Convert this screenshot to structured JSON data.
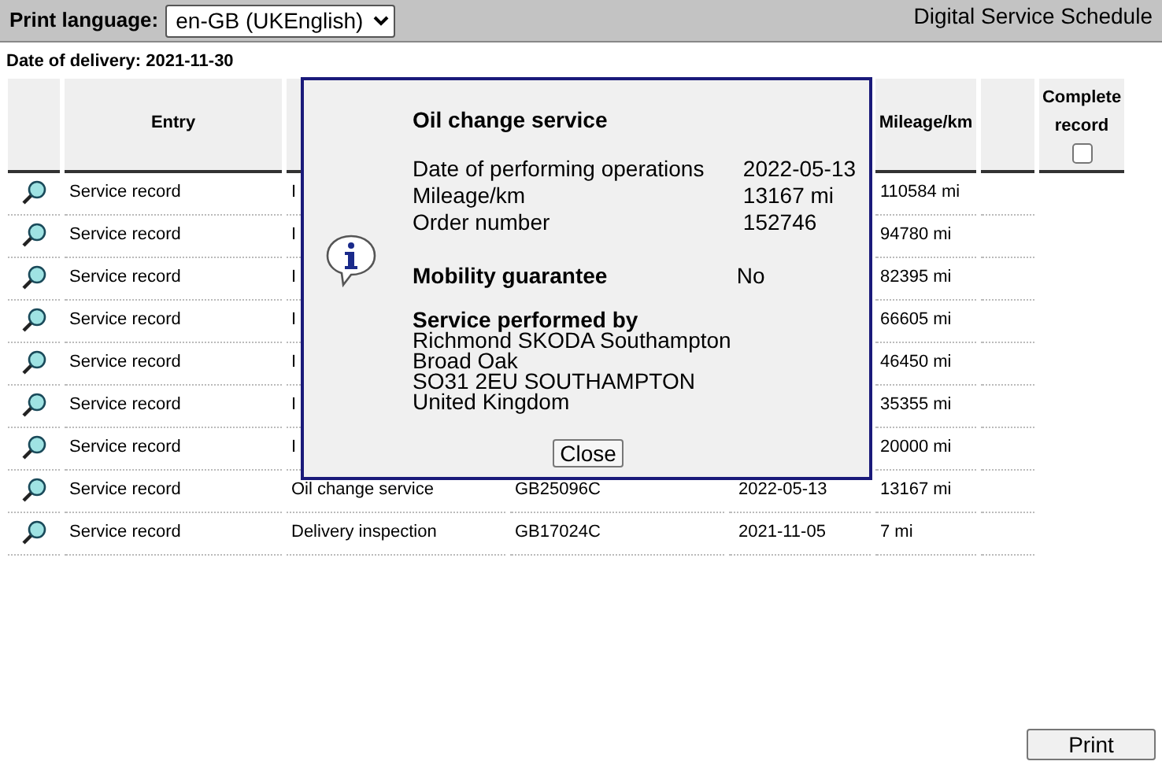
{
  "header": {
    "print_language_label": "Print language:",
    "language": "en-GB (UKEnglish)",
    "title": "Digital Service Schedule"
  },
  "date_of_delivery": "Date of delivery: 2021-11-30",
  "table": {
    "columns": [
      {},
      {
        "label": "Entry"
      },
      {},
      {},
      {},
      {
        "label": "Mileage/km"
      },
      {},
      {
        "label": "Complete record",
        "kind": "checkbox",
        "checked": false
      }
    ],
    "rows": [
      {
        "entry": "Service record",
        "column_3": "I",
        "mileage": "110584 mi"
      },
      {
        "entry": "Service record",
        "column_3": "I",
        "mileage": "94780 mi"
      },
      {
        "entry": "Service record",
        "column_3": "I",
        "mileage": "82395 mi"
      },
      {
        "entry": "Service record",
        "column_3": "I",
        "mileage": "66605 mi"
      },
      {
        "entry": "Service record",
        "column_3": "I",
        "mileage": "46450 mi"
      },
      {
        "entry": "Service record",
        "column_3": "I",
        "mileage": "35355 mi"
      },
      {
        "entry": "Service record",
        "column_3": "I",
        "mileage": "20000 mi"
      },
      {
        "entry": "Service record",
        "column_3": "Oil change service",
        "column_4": "GB25096C",
        "column_5": "2022-05-13",
        "mileage": "13167 mi"
      },
      {
        "entry": "Service record",
        "column_3": "Delivery inspection",
        "column_4": "GB17024C",
        "column_5": "2021-11-05",
        "mileage": "7 mi"
      }
    ]
  },
  "dialog": {
    "title": "Oil change service",
    "details": [
      {
        "label": "Date of performing operations",
        "value": "2022-05-13"
      },
      {
        "label": "Mileage/km",
        "value": "13167 mi"
      },
      {
        "label": "Order number",
        "value": "152746"
      }
    ],
    "mobility": {
      "label": "Mobility guarantee",
      "value": "No"
    },
    "performed_by": {
      "label": "Service performed by",
      "lines": [
        "Richmond SKODA Southampton",
        "Broad Oak",
        "SO31 2EU SOUTHAMPTON",
        "United Kingdom"
      ]
    },
    "close_button": "Close"
  },
  "print_button": "Print"
}
